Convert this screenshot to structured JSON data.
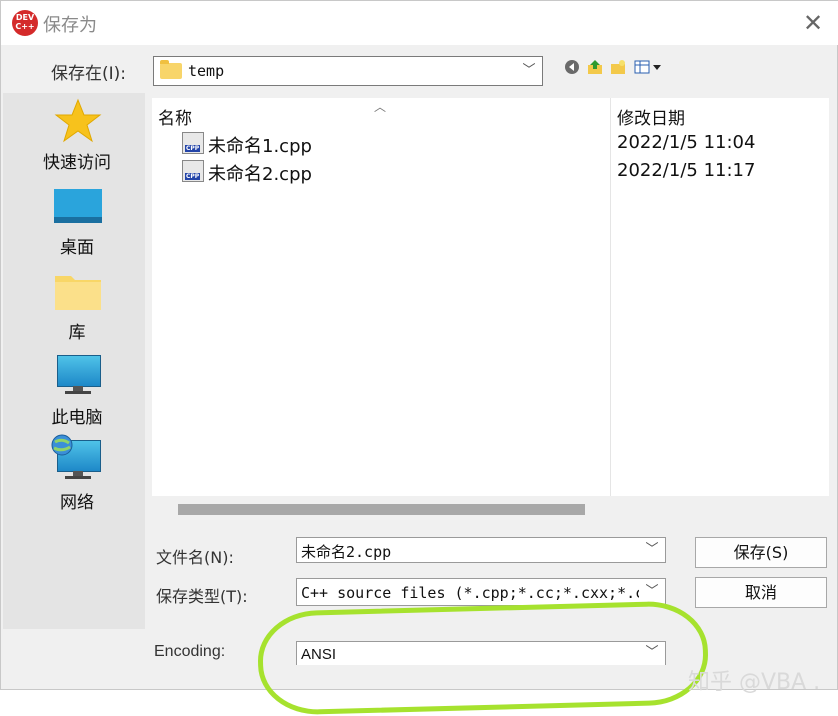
{
  "window": {
    "app_icon_text": "DEV C++",
    "title": "保存为",
    "close": "✕"
  },
  "location": {
    "label": "保存在(I):",
    "value": "temp"
  },
  "toolbar": {
    "back_icon": "back-icon",
    "up_icon": "up-folder-icon",
    "new_folder_icon": "new-folder-icon",
    "view_icon": "view-menu-icon"
  },
  "places": [
    {
      "label": "快速访问",
      "icon": "star-icon"
    },
    {
      "label": "桌面",
      "icon": "desktop-icon"
    },
    {
      "label": "库",
      "icon": "library-folder-icon"
    },
    {
      "label": "此电脑",
      "icon": "computer-icon"
    },
    {
      "label": "网络",
      "icon": "network-icon"
    }
  ],
  "filelist": {
    "columns": {
      "name": "名称",
      "date": "修改日期"
    },
    "files": [
      {
        "name": "未命名1.cpp",
        "date": "2022/1/5 11:04",
        "icon_text": "CPP"
      },
      {
        "name": "未命名2.cpp",
        "date": "2022/1/5 11:17",
        "icon_text": "CPP"
      }
    ]
  },
  "form": {
    "filename_label": "文件名(N):",
    "filename_value": "未命名2.cpp",
    "filetype_label": "保存类型(T):",
    "filetype_value": "C++ source files (*.cpp;*.cc;*.cxx;*.c",
    "encoding_label": "Encoding:",
    "encoding_value": "ANSI"
  },
  "buttons": {
    "save": "保存(S)",
    "cancel": "取消"
  },
  "watermark": "知乎 @VBA .",
  "colors": {
    "highlight": "#a6e22e",
    "dialog_bg": "#f0f0f0",
    "places_bg": "#e4e4e4"
  }
}
